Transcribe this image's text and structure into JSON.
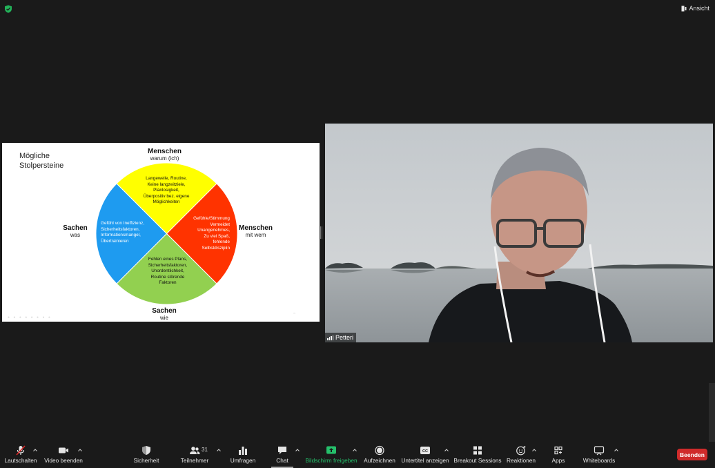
{
  "window": {
    "view_label": "Ansicht"
  },
  "slide": {
    "title": "Mögliche\nStolpersteine",
    "top": {
      "main": "Menschen",
      "sub": "warum (ich)"
    },
    "right": {
      "main": "Menschen",
      "sub": "mit wem"
    },
    "bottom": {
      "main": "Sachen",
      "sub": "wie"
    },
    "left": {
      "main": "Sachen",
      "sub": "was"
    },
    "quadrants": {
      "yellow": "Langeweile, Routine,\nKeine langzeitziele,\nPlanlosigkeit,\nÜberpositiv bez. eigene\nMöglichkeiten",
      "red": "Gefühle/Stimmung\nVermeidet\nUnangenehmes,\nZu viel Spaß,\nfehlende\nSelbstdisziplin",
      "green": "Fehlen eines Plans,\nSicherheitsfaktoren,\nUnordentlichkeit,\nRoutine störende\nFaktoren",
      "blue": "Gefühl von Ineffizienz,\nSicherheitsfaktoren,\nInformationsmangel,\nÜbertrainieren"
    },
    "colors": {
      "yellow": "#ffff00",
      "red": "#ff3300",
      "green": "#92d050",
      "blue": "#1e9bf0"
    }
  },
  "participant": {
    "name": "Petteri"
  },
  "toolbar": {
    "mute": "Lautschalten",
    "video": "Video beenden",
    "security": "Sicherheit",
    "participants": "Teilnehmer",
    "participants_count": "31",
    "polls": "Umfragen",
    "chat": "Chat",
    "share": "Bildschirm freigeben",
    "record": "Aufzeichnen",
    "captions": "Untertitel anzeigen",
    "breakout": "Breakout Sessions",
    "reactions": "Reaktionen",
    "apps": "Apps",
    "whiteboards": "Whiteboards",
    "end": "Beenden"
  },
  "colors": {
    "share_green": "#25c06b",
    "end_red": "#cf2b2b",
    "bg": "#1a1a1a"
  }
}
